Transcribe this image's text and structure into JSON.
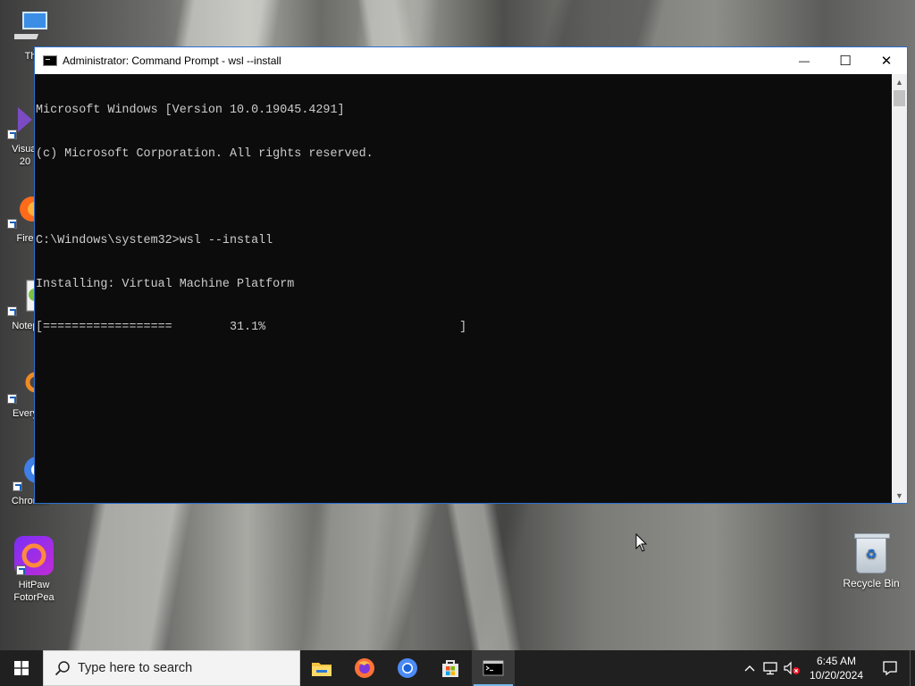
{
  "desktop": {
    "icons": [
      {
        "label": "This",
        "glyph": "computer-icon"
      },
      {
        "label": "Visual\n20",
        "glyph": "visual-studio-icon"
      },
      {
        "label": "Fire",
        "glyph": "firefox-icon"
      },
      {
        "label": "Notep",
        "glyph": "notepad-plus-icon"
      },
      {
        "label": "Every",
        "glyph": "everything-icon"
      },
      {
        "label": "Chrom...",
        "glyph": "chromium-icon"
      },
      {
        "label": "HitPaw\nFotorPea",
        "glyph": "hitpaw-icon"
      }
    ],
    "recycle_bin": {
      "label": "Recycle Bin"
    }
  },
  "window": {
    "title": "Administrator: Command Prompt - wsl  --install",
    "min_glyph": "—",
    "max_glyph": "☐",
    "close_glyph": "✕",
    "console_lines": [
      "Microsoft Windows [Version 10.0.19045.4291]",
      "(c) Microsoft Corporation. All rights reserved.",
      "",
      "C:\\Windows\\system32>wsl --install",
      "Installing: Virtual Machine Platform",
      "[==================        31.1%                           ]"
    ]
  },
  "taskbar": {
    "search_placeholder": "Type here to search",
    "apps": [
      "file-explorer-icon",
      "firefox-icon",
      "chromium-icon",
      "microsoft-store-icon",
      "command-prompt-icon"
    ],
    "clock_time": "6:45 AM",
    "clock_date": "10/20/2024"
  }
}
